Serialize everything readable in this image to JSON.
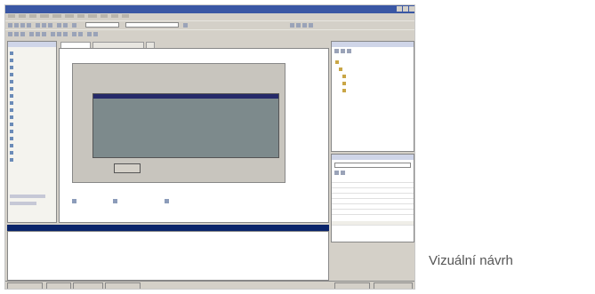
{
  "caption": "Vizuální návrh",
  "screenshot": {
    "title": "",
    "form_label": "",
    "button_label": "",
    "output_text": ""
  }
}
